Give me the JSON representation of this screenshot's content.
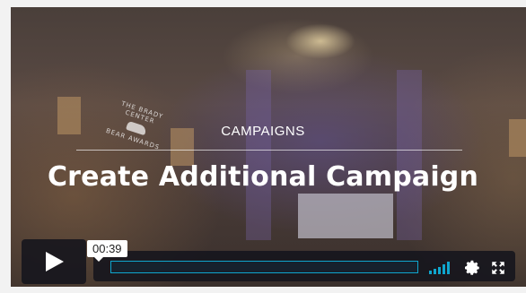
{
  "overlay": {
    "eyebrow": "CAMPAIGNS",
    "headline": "Create Additional Campaign"
  },
  "logo": {
    "line1": "THE BRADY CENTER",
    "line2": "BEAR AWARDS"
  },
  "controls": {
    "timestamp": "00:39",
    "progress_fraction": 0.0,
    "accent_color": "#0fa6ce",
    "icons": [
      "play-icon",
      "volume-icon",
      "settings-gear-icon",
      "fullscreen-icon"
    ]
  }
}
